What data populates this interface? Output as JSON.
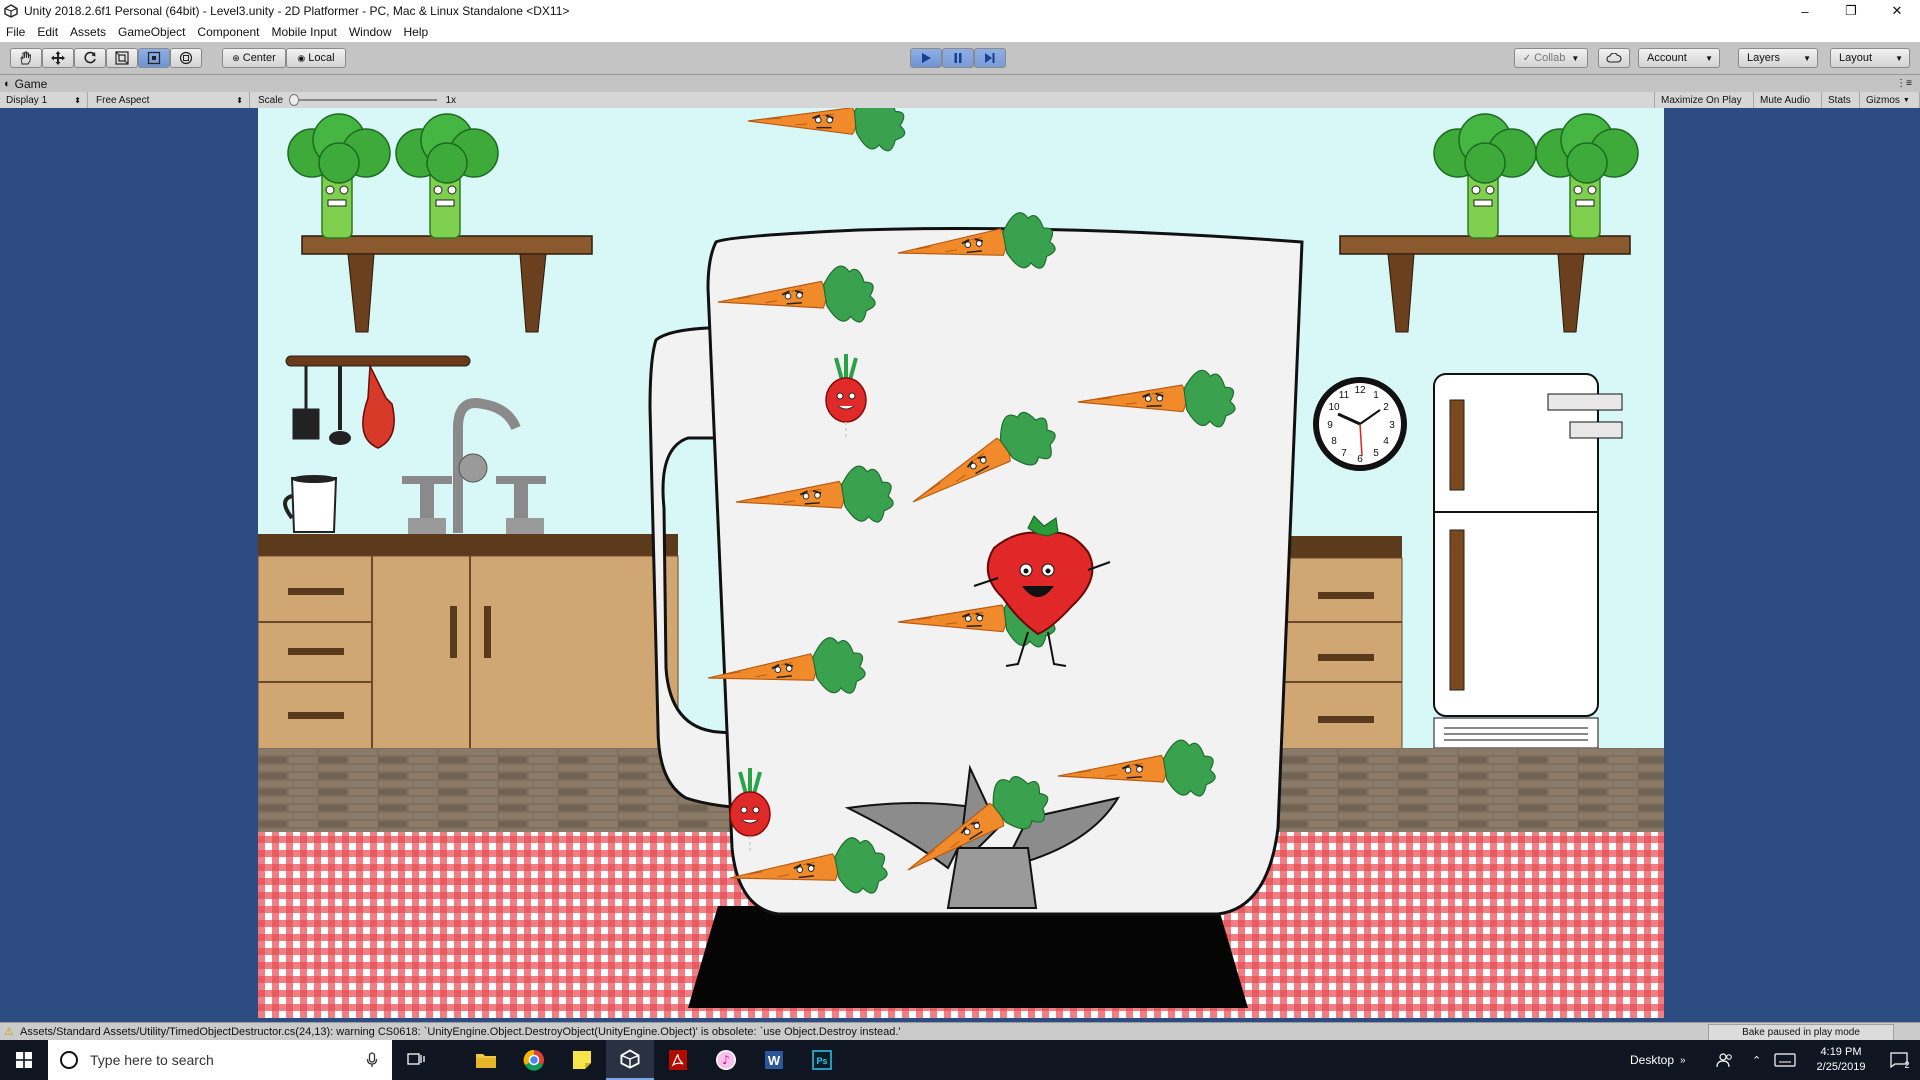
{
  "window": {
    "title": "Unity 2018.2.6f1 Personal (64bit) - Level3.unity - 2D Platformer - PC, Mac & Linux Standalone <DX11>",
    "controls": [
      "–",
      "❐",
      "✕"
    ]
  },
  "menu": [
    "File",
    "Edit",
    "Assets",
    "GameObject",
    "Component",
    "Mobile Input",
    "Window",
    "Help"
  ],
  "toolbar": {
    "pivot_mode": "Center",
    "pivot_space": "Local",
    "collab": "Collab",
    "account": "Account",
    "layers": "Layers",
    "layout": "Layout",
    "play_state": "playing"
  },
  "game_panel": {
    "tab_label": "Game",
    "display": "Display 1",
    "aspect": "Free Aspect",
    "scale_label": "Scale",
    "scale_value": "1x",
    "options": [
      "Maximize On Play",
      "Mute Audio",
      "Stats",
      "Gizmos"
    ]
  },
  "scene": {
    "clock_numbers": [
      "12",
      "1",
      "2",
      "3",
      "4",
      "5",
      "6",
      "7",
      "8",
      "9",
      "10",
      "11"
    ],
    "colors": {
      "wall": "#d8f8f8",
      "cabinet": "#d0a672",
      "counter": "#5a3a1e",
      "brick": "#7a6a58",
      "table": "#e04048",
      "blender_body": "#f2f2f2",
      "blender_base": "#000000",
      "carrot": "#f08a2a",
      "leaf": "#2e9a44",
      "strawberry": "#e02828"
    }
  },
  "console": {
    "message": "Assets/Standard Assets/Utility/TimedObjectDestructor.cs(24,13): warning CS0618: `UnityEngine.Object.DestroyObject(UnityEngine.Object)' is obsolete: `use Object.Destroy instead.'",
    "bake_status": "Bake paused in play mode"
  },
  "taskbar": {
    "search_placeholder": "Type here to search",
    "apps": [
      "file-explorer",
      "chrome",
      "sticky-notes",
      "unity",
      "acrobat",
      "itunes",
      "word",
      "photoshop"
    ],
    "desktop_label": "Desktop",
    "time": "4:19 PM",
    "date": "2/25/2019",
    "notifications": "2"
  }
}
